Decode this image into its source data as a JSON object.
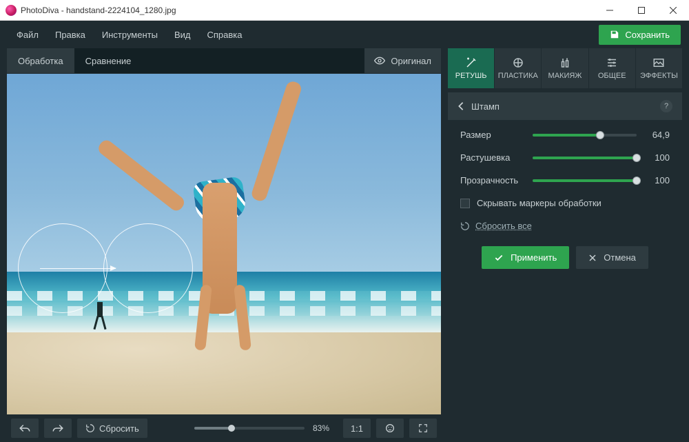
{
  "titlebar": {
    "title": "PhotoDiva - handstand-2224104_1280.jpg"
  },
  "menubar": {
    "items": [
      "Файл",
      "Правка",
      "Инструменты",
      "Вид",
      "Справка"
    ],
    "save_label": "Сохранить"
  },
  "view_tabs": {
    "edit": "Обработка",
    "compare": "Сравнение",
    "original": "Оригинал"
  },
  "bottom": {
    "reset": "Сбросить",
    "zoom_pct": "83%",
    "one_to_one": "1:1"
  },
  "tool_tabs": [
    "РЕТУШЬ",
    "ПЛАСТИКА",
    "МАКИЯЖ",
    "ОБЩЕЕ",
    "ЭФФЕКТЫ"
  ],
  "panel": {
    "title": "Штамп",
    "sliders": {
      "size": {
        "label": "Размер",
        "value": "64,9",
        "pct": 65
      },
      "feather": {
        "label": "Растушевка",
        "value": "100",
        "pct": 100
      },
      "opacity": {
        "label": "Прозрачность",
        "value": "100",
        "pct": 100
      }
    },
    "hide_markers": "Скрывать маркеры обработки",
    "reset_all": "Сбросить все",
    "apply": "Применить",
    "cancel": "Отмена"
  }
}
